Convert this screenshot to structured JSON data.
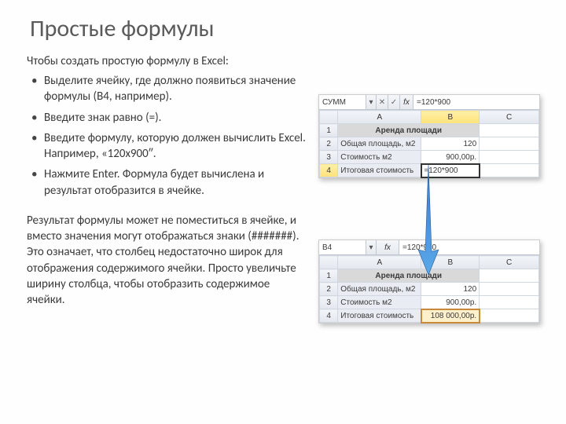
{
  "title": "Простые формулы",
  "intro": "Чтобы создать простую формулу в Excel:",
  "steps": [
    "Выделите ячейку, где должно появиться значение формулы (B4, например).",
    "Введите знак равно (=).",
    "Введите формулу, которую должен вычислить Excel. Например, «120x900″.",
    "Нажмите Enter. Формула будет вычислена и результат отобразится в ячейке."
  ],
  "note": "Результат формулы может не поместиться в ячейке, и вместо значения могут отображаться знаки (#######). Это означает, что столбец недостаточно широк для отображения содержимого ячейки. Просто  увеличьте ширину столбца, чтобы отобразить содержимое ячейки.",
  "excel1": {
    "namebox": "СУММ",
    "formula": "=120*900",
    "cols": [
      "A",
      "B",
      "C"
    ],
    "header": "Аренда площади",
    "rows": [
      {
        "a": "Общая площадь, м2",
        "b": "120"
      },
      {
        "a": "Стоимость м2",
        "b": "900,00р."
      },
      {
        "a": "Итоговая стоимость",
        "b": "=120*900"
      }
    ]
  },
  "excel2": {
    "namebox": "B4",
    "formula": "=120*900",
    "cols": [
      "A",
      "B",
      "C"
    ],
    "header": "Аренда площади",
    "rows": [
      {
        "a": "Общая площадь, м2",
        "b": "120"
      },
      {
        "a": "Стоимость м2",
        "b": "900,00р."
      },
      {
        "a": "Итоговая стоимость",
        "b": "108 000,00р."
      }
    ]
  },
  "fx": "fx"
}
